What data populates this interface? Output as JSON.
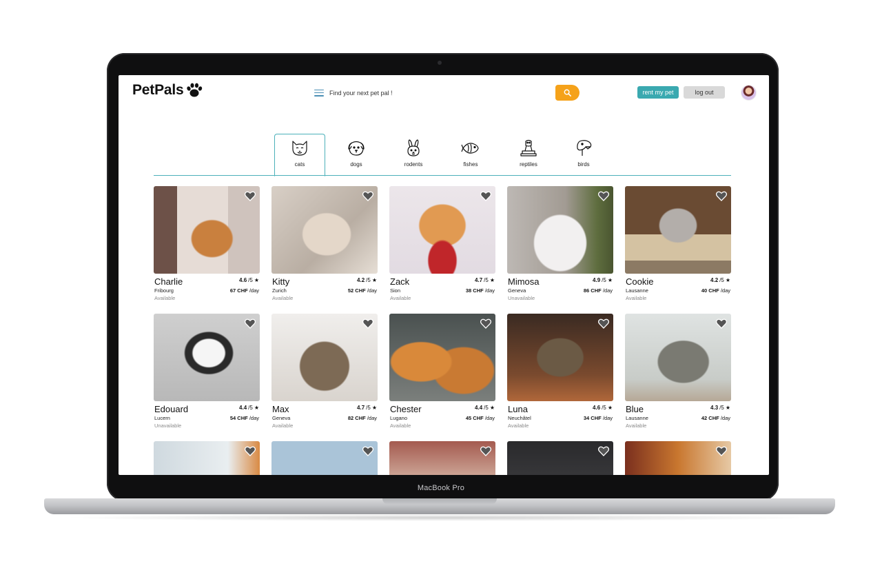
{
  "device": {
    "label": "MacBook Pro"
  },
  "header": {
    "logo_text": "PetPals",
    "search_placeholder": "Find your next pet pal !",
    "rent_label": "rent my pet",
    "logout_label": "log out"
  },
  "colors": {
    "accent": "#3aa9b0",
    "search_button": "#f5a21a",
    "tab_border": "#4bb0b9"
  },
  "categories": [
    {
      "label": "cats",
      "icon": "cat-icon",
      "active": true
    },
    {
      "label": "dogs",
      "icon": "dog-icon",
      "active": false
    },
    {
      "label": "rodents",
      "icon": "rabbit-icon",
      "active": false
    },
    {
      "label": "fishes",
      "icon": "fish-icon",
      "active": false
    },
    {
      "label": "reptiles",
      "icon": "reptile-icon",
      "active": false
    },
    {
      "label": "birds",
      "icon": "bird-icon",
      "active": false
    }
  ],
  "pets": [
    {
      "name": "Charlie",
      "city": "Fribourg",
      "status": "Available",
      "rating": "4.6",
      "price": "67 CHF"
    },
    {
      "name": "Kitty",
      "city": "Zurich",
      "status": "Available",
      "rating": "4.2",
      "price": "52 CHF"
    },
    {
      "name": "Zack",
      "city": "Sion",
      "status": "Available",
      "rating": "4.7",
      "price": "38 CHF"
    },
    {
      "name": "Mimosa",
      "city": "Geneva",
      "status": "Unavailable",
      "rating": "4.9",
      "price": "86 CHF"
    },
    {
      "name": "Cookie",
      "city": "Lausanne",
      "status": "Available",
      "rating": "4.2",
      "price": "40 CHF"
    },
    {
      "name": "Edouard",
      "city": "Lucern",
      "status": "Unavailable",
      "rating": "4.4",
      "price": "54 CHF"
    },
    {
      "name": "Max",
      "city": "Geneva",
      "status": "Available",
      "rating": "4.7",
      "price": "82 CHF"
    },
    {
      "name": "Chester",
      "city": "Lugano",
      "status": "Available",
      "rating": "4.4",
      "price": "45 CHF"
    },
    {
      "name": "Luna",
      "city": "Neuchâtel",
      "status": "Available",
      "rating": "4.6",
      "price": "34 CHF"
    },
    {
      "name": "Blue",
      "city": "Lausanne",
      "status": "Available",
      "rating": "4.3",
      "price": "42 CHF"
    }
  ],
  "rating_suffix": "/5",
  "price_suffix": "/day"
}
